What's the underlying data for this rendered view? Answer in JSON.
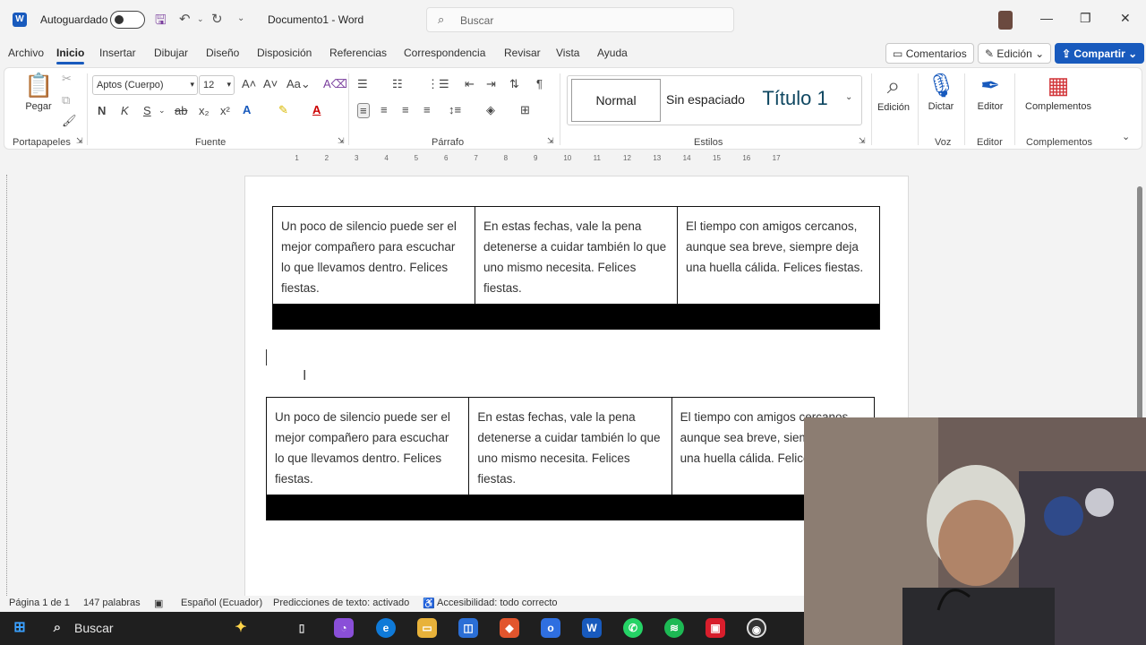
{
  "titlebar": {
    "autosave_label": "Autoguardado",
    "doc_title": "Documento1 - Word",
    "search_placeholder": "Buscar"
  },
  "menu": {
    "tabs": [
      "Archivo",
      "Inicio",
      "Insertar",
      "Dibujar",
      "Diseño",
      "Disposición",
      "Referencias",
      "Correspondencia",
      "Revisar",
      "Vista",
      "Ayuda"
    ],
    "active_tab": "Inicio",
    "comentarios": "Comentarios",
    "edicion": "Edición",
    "compartir": "Compartir"
  },
  "ribbon": {
    "pegar": "Pegar",
    "font_name": "Aptos (Cuerpo)",
    "font_size": "12",
    "bold_label": "N",
    "italic_label": "K",
    "underline_label": "S",
    "styles": [
      "Normal",
      "Sin espaciado",
      "Título 1"
    ],
    "edicion": "Edición",
    "dictar": "Dictar",
    "editor": "Editor",
    "complementos": "Complementos",
    "groups": {
      "portapapeles": "Portapapeles",
      "fuente": "Fuente",
      "parrafo": "Párrafo",
      "estilos": "Estilos",
      "voz": "Voz",
      "editor": "Editor",
      "complementos": "Complementos"
    }
  },
  "ruler": {
    "marks": [
      "1",
      "2",
      "3",
      "4",
      "5",
      "6",
      "7",
      "8",
      "9",
      "10",
      "11",
      "12",
      "13",
      "14",
      "15",
      "16",
      "17"
    ]
  },
  "document": {
    "table1": [
      "Un poco de silencio puede ser el mejor compañero para escuchar lo que llevamos dentro. Felices fiestas.",
      "En estas fechas, vale la pena detenerse a cuidar también lo que uno mismo necesita. Felices fiestas.",
      "El tiempo con amigos cercanos, aunque sea breve, siempre deja una huella cálida. Felices fiestas."
    ],
    "table2": [
      "Un poco de silencio puede ser el mejor compañero para escuchar lo que llevamos dentro. Felices fiestas.",
      "En estas fechas, vale la pena detenerse a cuidar también lo que uno mismo necesita. Felices fiestas.",
      "El tiempo con amigos cercanos, aunque sea breve, siempre deja una huella cálida. Felices fiestas."
    ]
  },
  "status": {
    "page": "Página 1 de 1",
    "words": "147 palabras",
    "language": "Español (Ecuador)",
    "predictions": "Predicciones de texto: activado",
    "accessibility": "Accesibilidad: todo correcto"
  },
  "taskbar": {
    "search": "Buscar"
  },
  "colors": {
    "accent": "#185abd",
    "title_style": "#0f4761"
  }
}
